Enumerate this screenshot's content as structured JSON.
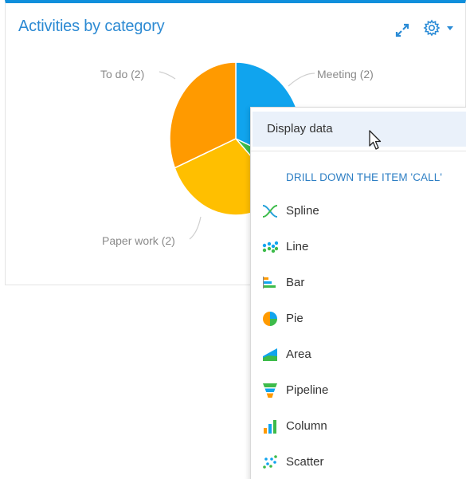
{
  "widget": {
    "title": "Activities by category",
    "accent_color": "#0f8fdc",
    "expand_icon": "expand-icon",
    "settings_icon": "gear-icon"
  },
  "chart_data": {
    "type": "pie",
    "title": "Activities by category",
    "slices": [
      {
        "label": "Meeting (2)",
        "value": 2,
        "color": "#10a4ee"
      },
      {
        "label": "Call",
        "value": 0.4,
        "color": "#3dbb4a"
      },
      {
        "label": "Paper work (2)",
        "value": 2,
        "color": "#ffbf00"
      },
      {
        "label": "To do (2)",
        "value": 2,
        "color": "#ff9a00"
      }
    ],
    "visible_labels": {
      "todo": "To do (2)",
      "meeting": "Meeting (2)",
      "paper": "Paper work (2)"
    }
  },
  "menu": {
    "display_data": "Display data",
    "section_title": "DRILL DOWN THE ITEM 'CALL'",
    "items": [
      {
        "label": "Spline",
        "icon": "spline-icon"
      },
      {
        "label": "Line",
        "icon": "line-icon"
      },
      {
        "label": "Bar",
        "icon": "bar-icon"
      },
      {
        "label": "Pie",
        "icon": "pie-icon"
      },
      {
        "label": "Area",
        "icon": "area-icon"
      },
      {
        "label": "Pipeline",
        "icon": "pipeline-icon"
      },
      {
        "label": "Column",
        "icon": "column-icon"
      },
      {
        "label": "Scatter",
        "icon": "scatter-icon"
      }
    ]
  }
}
